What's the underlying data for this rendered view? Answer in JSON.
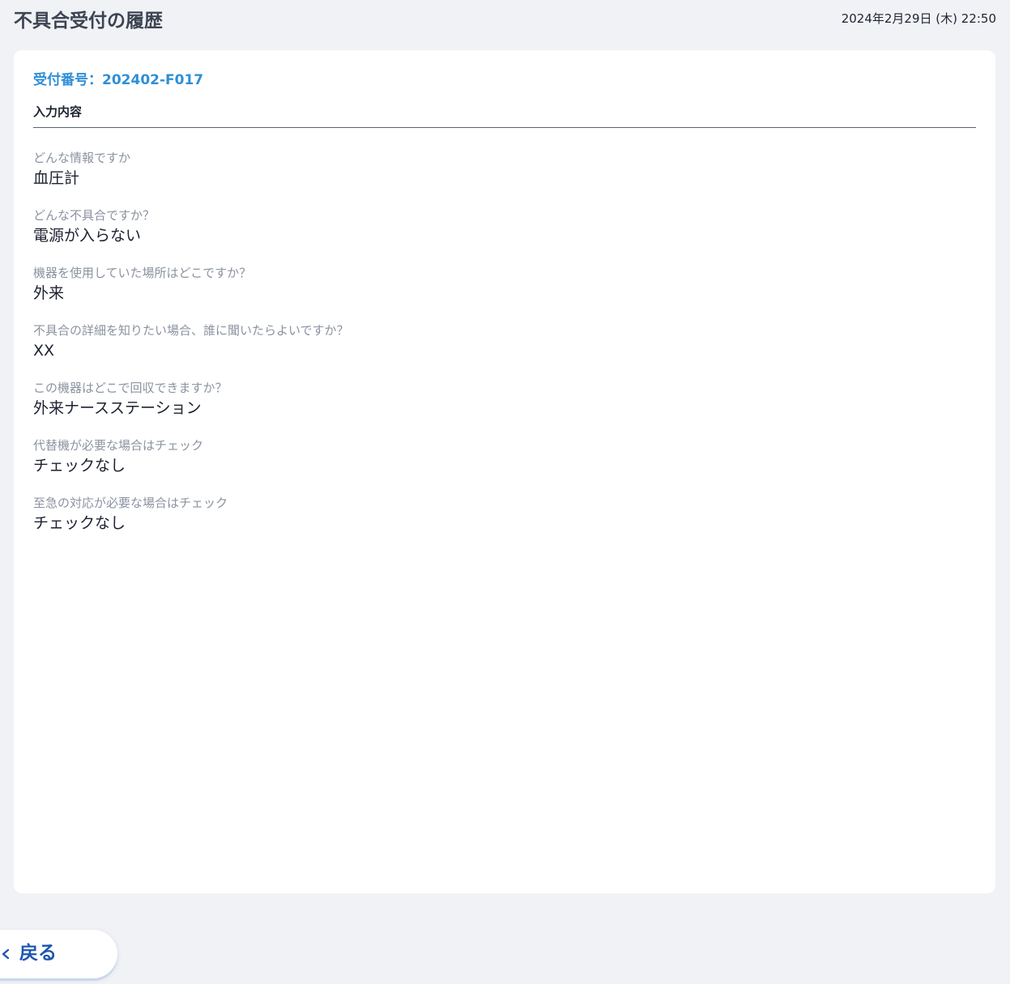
{
  "header": {
    "title": "不具合受付の履歴",
    "datetime": "2024年2月29日 (木) 22:50"
  },
  "card": {
    "receipt_number": "受付番号：202402-F017",
    "section_title": "入力内容",
    "fields": [
      {
        "label": "どんな情報ですか",
        "value": "血圧計"
      },
      {
        "label": "どんな不具合ですか？",
        "value": "電源が入らない"
      },
      {
        "label": "機器を使用していた場所はどこですか？",
        "value": "外来"
      },
      {
        "label": "不具合の詳細を知りたい場合、誰に聞いたらよいですか？",
        "value": "XX"
      },
      {
        "label": "この機器はどこで回収できますか？",
        "value": "外来ナースステーション"
      },
      {
        "label": "代替機が必要な場合はチェック",
        "value": "チェックなし"
      },
      {
        "label": "至急の対応が必要な場合はチェック",
        "value": "チェックなし"
      }
    ]
  },
  "footer": {
    "back_label": "戻る",
    "back_icon": "chevron-left-icon"
  },
  "colors": {
    "accent": "#2f8fd6",
    "back_text": "#1d56b0",
    "background": "#f0f2f6"
  }
}
